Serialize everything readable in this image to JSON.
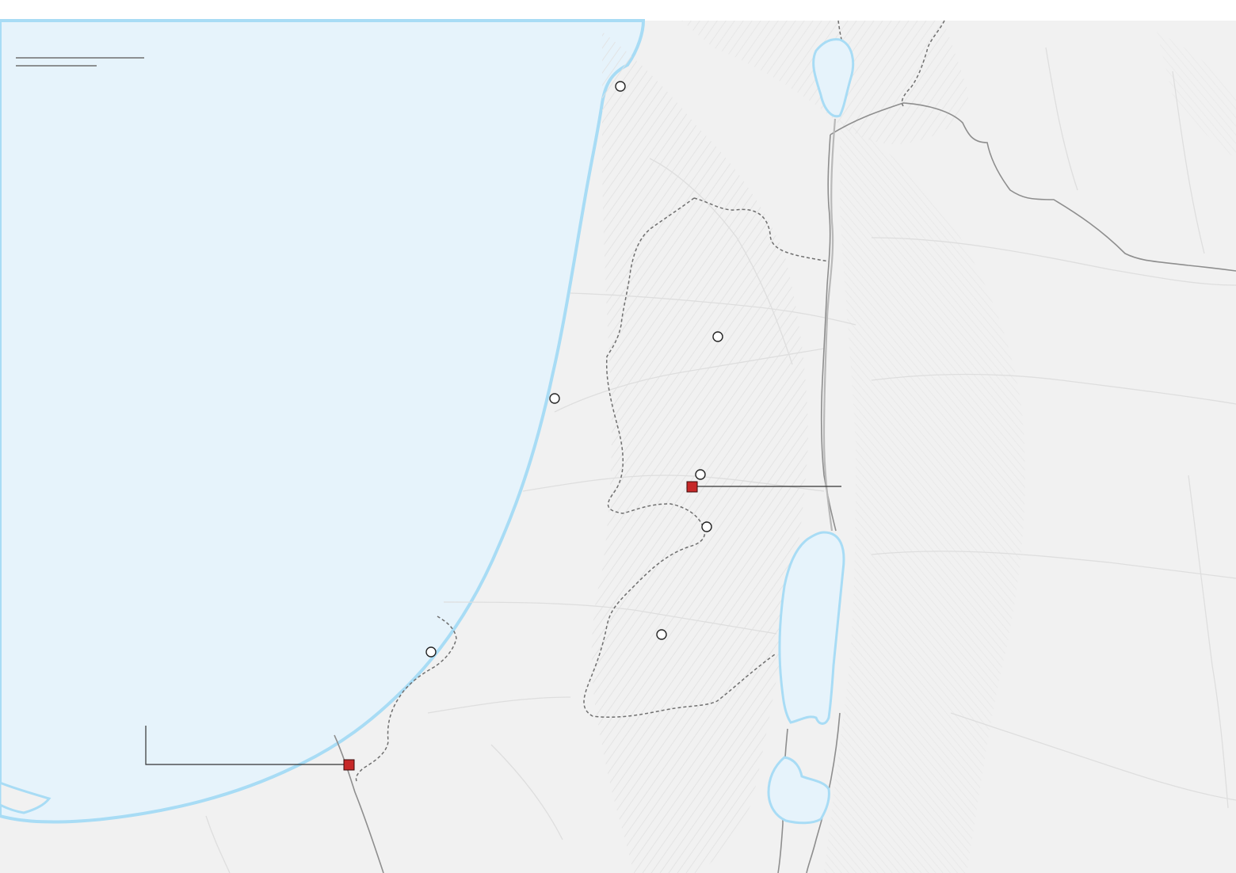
{
  "map": {
    "colors": {
      "sea": "#e6f3fb",
      "coast": "#a8dcf5",
      "land": "#f1f1f1",
      "relief": "#d9d9d9",
      "border_solid": "#8e8e8e",
      "border_dashed": "#6f6f6f",
      "city_marker_fill": "#ffffff",
      "city_marker_stroke": "#222222",
      "highlight_marker": "#c62828",
      "leader_line": "#333333"
    },
    "legend": {
      "title": "",
      "subtitle": ""
    },
    "water_bodies": [
      "mediterranean-sea",
      "sea-of-galilee",
      "dead-sea-north-basin",
      "dead-sea-south-basin"
    ],
    "city_markers": [
      {
        "id": "marker-1",
        "label": ""
      },
      {
        "id": "marker-2",
        "label": ""
      },
      {
        "id": "marker-3",
        "label": ""
      },
      {
        "id": "marker-4",
        "label": ""
      },
      {
        "id": "marker-5",
        "label": ""
      },
      {
        "id": "marker-6",
        "label": ""
      },
      {
        "id": "marker-7",
        "label": ""
      }
    ],
    "highlight_markers": [
      {
        "id": "highlight-1",
        "label": ""
      },
      {
        "id": "highlight-2",
        "label": ""
      }
    ]
  }
}
